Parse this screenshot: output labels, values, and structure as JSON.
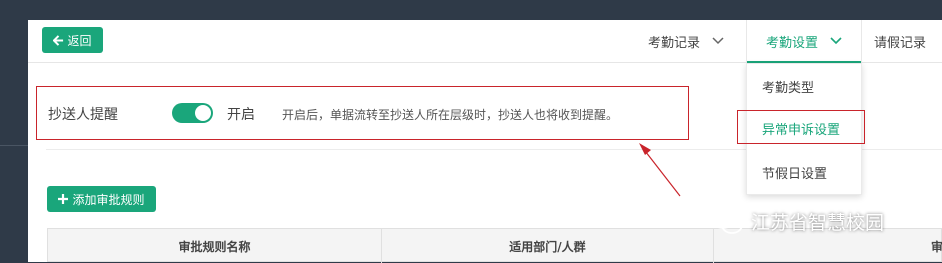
{
  "header": {
    "back_label": "返回",
    "nav": [
      {
        "label": "考勤记录"
      },
      {
        "label": "考勤设置"
      },
      {
        "label": "请假记录"
      }
    ]
  },
  "dropdown": {
    "items": [
      {
        "label": "考勤类型"
      },
      {
        "label": "异常申诉设置"
      },
      {
        "label": "节假日设置"
      }
    ]
  },
  "reminder": {
    "label": "抄送人提醒",
    "toggle_on": true,
    "toggle_text": "开启",
    "description": "开启后，单据流转至抄送人所在层级时，抄送人也将收到提醒。"
  },
  "actions": {
    "add_rule_label": "添加审批规则"
  },
  "table": {
    "headers": [
      "审批规则名称",
      "适用部门/人群",
      "审"
    ]
  },
  "watermark": {
    "text": "江苏省智慧校园"
  },
  "colors": {
    "accent": "#1aa67b",
    "highlight_border": "#c9242b",
    "background": "#2f3a48"
  }
}
